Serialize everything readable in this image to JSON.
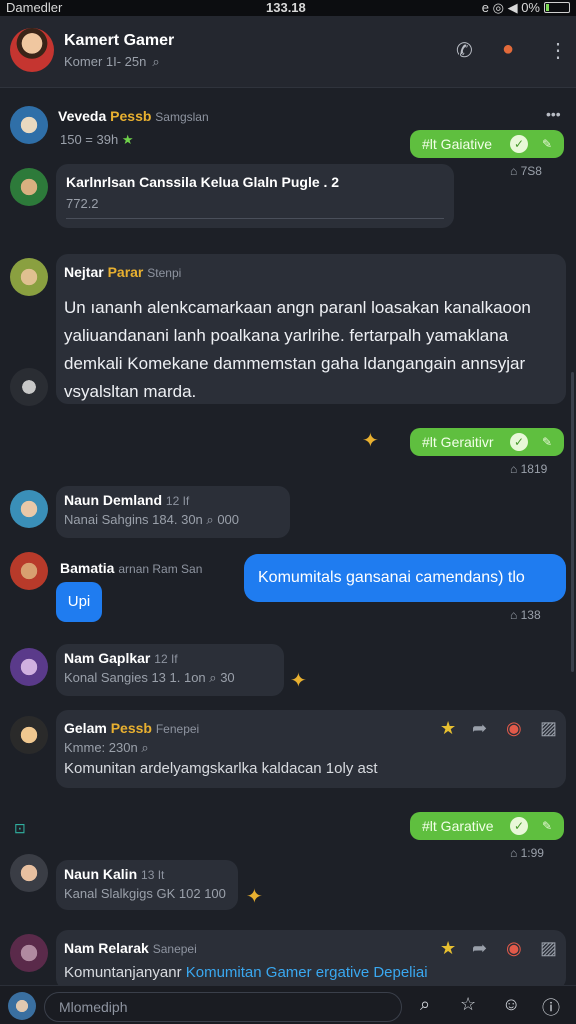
{
  "status_bar": {
    "left": "Damedler",
    "time": "133.18",
    "right": "e ◎ ◀ 0%"
  },
  "header": {
    "title": "Kamert Gamer",
    "subtitle": "Komer 1I- 25n",
    "icons": [
      "phone-icon",
      "notification-icon",
      "more-icon"
    ]
  },
  "messages": [
    {
      "name": "Veveda",
      "name_accent": "Pessb",
      "role": "Samgslan",
      "meta": "150 = 39h",
      "star": "★"
    },
    {
      "green_label": "#lt Gaiative",
      "time": "7S8"
    },
    {
      "text": "Karlnrlsan Canssila  Kelua   Glaln   Pugle . 2",
      "meta": "772.2"
    },
    {
      "name": "Nejtar",
      "name_accent": "Parar",
      "role": "Stenpi",
      "text": "Un ıananh alenkcamarkaan angn paranl loasakan kanalkaoon yaliuandanani lanh poalkana yarlrihe. fertarpalh yamaklana demkali Komekane dammemstan gaha ldangangain annsyjar vsyalsltan marda."
    },
    {
      "green_label": "#lt Geraitivr",
      "time": "1819"
    },
    {
      "name": "Naun Demland",
      "tag": "12 If",
      "meta": "Nanai Sahgins 184. 30n",
      "count": "000"
    },
    {
      "name": "Bamatia",
      "role": "arnan Ram San",
      "blue_text": "Komumitals gansanai camendans)  tlo",
      "reply": "Upi",
      "time": "138"
    },
    {
      "name": "Nam Gaplkar",
      "tag": "12 If",
      "meta": "Konal Sangies 13 1. 1on",
      "count": "30"
    },
    {
      "name": "Gelam",
      "name_accent": "Pessb",
      "role": "Fenepei",
      "meta": "Kmme: 230n",
      "text": "Komunitan ardelyamgskarlka kaldacan 1oly ast"
    },
    {
      "green_label": "#lt Garative",
      "time": "1:99"
    },
    {
      "name": "Naun Kalin",
      "tag": "13 It",
      "meta": "Kanal Slalkgigs GK 102 100"
    },
    {
      "name": "Nam Relarak",
      "role": "Sanepei",
      "text": "Komuntanjanyanr",
      "link_text": "Komumitan Gamer ergative Depeliai"
    }
  ],
  "composer": {
    "placeholder": "Mlomediph"
  },
  "colors": {
    "bg": "#1d2027",
    "green": "#5fbf3f",
    "blue": "#1f7cf0",
    "accent": "#e8b030"
  }
}
